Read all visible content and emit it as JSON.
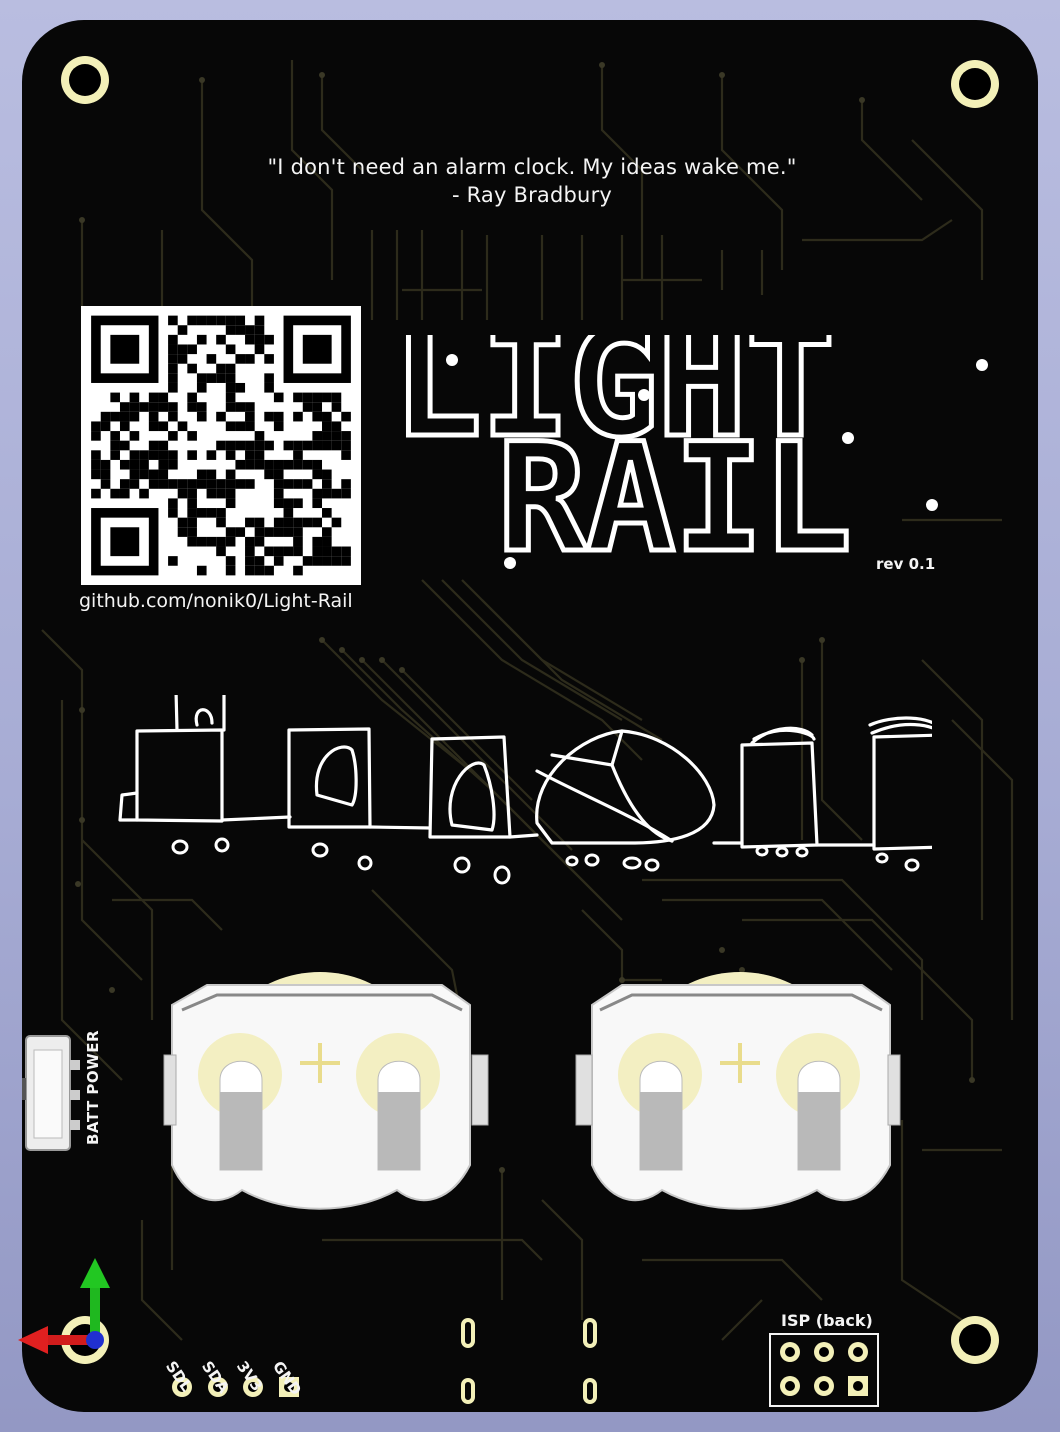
{
  "quote": {
    "line1": "\"I don't need an alarm clock. My ideas wake me.\"",
    "line2": "- Ray Bradbury"
  },
  "title": {
    "line1": "LIGHT",
    "line2": "RAIL",
    "revision": "rev 0.1"
  },
  "repo_url": "github.com/nonik0/Light-Rail",
  "labels": {
    "batt_power": "BATT POWER",
    "isp": "ISP  (back)",
    "pins": [
      "SDL",
      "SDA",
      "3V3",
      "GND"
    ]
  },
  "icons": [
    "qr-code-icon",
    "train-drawing-icon",
    "coin-cell-holder-icon",
    "axis-gizmo-icon"
  ],
  "colors": {
    "board": "#070707",
    "silkscreen": "#f4f4f4",
    "copper_trace": "#2c2a1a",
    "pad": "#f3f0b8",
    "background": "#a9aed6"
  }
}
